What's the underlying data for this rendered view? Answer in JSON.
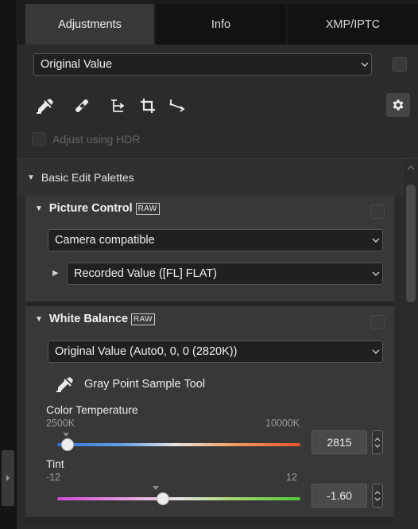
{
  "tabs": [
    {
      "label": "Adjustments",
      "active": true
    },
    {
      "label": "Info",
      "active": false
    },
    {
      "label": "XMP/IPTC",
      "active": false
    }
  ],
  "preset": {
    "value": "Original Value"
  },
  "tools": [
    "eyedropper-icon",
    "bandage-icon",
    "straighten-icon",
    "crop-icon",
    "perspective-icon"
  ],
  "hdr": {
    "label": "Adjust using HDR",
    "enabled": false
  },
  "basic": {
    "label": "Basic Edit Palettes"
  },
  "picture_control": {
    "title": "Picture Control",
    "raw_badge": "RAW",
    "mode": "Camera compatible",
    "recorded": "Recorded Value ([FL] FLAT)"
  },
  "white_balance": {
    "title": "White Balance",
    "raw_badge": "RAW",
    "mode": "Original Value (Auto0, 0, 0 (2820K))",
    "tool_label": "Gray Point Sample Tool",
    "color_temperature": {
      "label": "Color Temperature",
      "min_label": "2500K",
      "max_label": "10000K",
      "min": 2500,
      "max": 10000,
      "value": 2815,
      "value_text": "2815"
    },
    "tint": {
      "label": "Tint",
      "min_label": "-12",
      "max_label": "12",
      "min": -12,
      "max": 12,
      "value": -1.6,
      "value_text": "-1.60"
    }
  },
  "colors": {
    "panel_bg": "#2b2b2b",
    "section_bg": "#383838",
    "active_tab": "#383838"
  }
}
